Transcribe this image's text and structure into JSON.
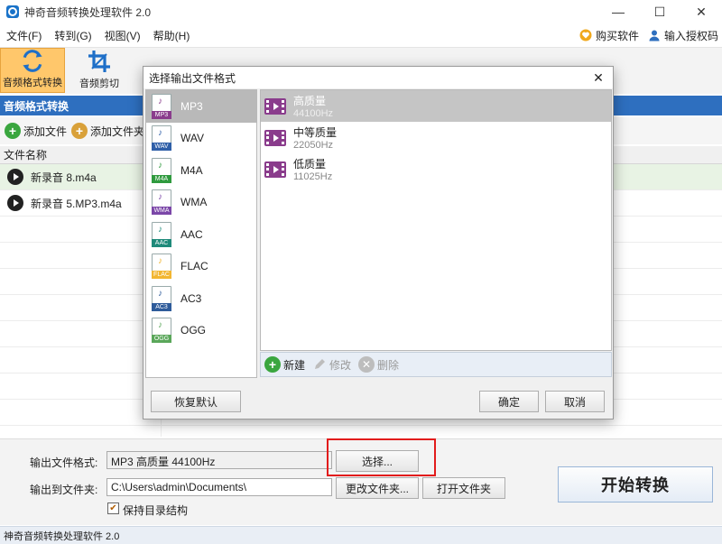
{
  "window": {
    "title": "神奇音频转换处理软件 2.0",
    "minimize_glyph": "—",
    "maximize_glyph": "☐",
    "close_glyph": "✕"
  },
  "menu": {
    "items": [
      "文件(F)",
      "转到(G)",
      "视图(V)",
      "帮助(H)"
    ],
    "buy": "购买软件",
    "license": "输入授权码"
  },
  "toolbar": {
    "tools": [
      {
        "label": "音频格式转换",
        "icon": "convert-icon",
        "active": true
      },
      {
        "label": "音频剪切",
        "icon": "crop-icon",
        "active": false
      }
    ]
  },
  "section": {
    "title": "音频格式转换"
  },
  "subtoolbar": {
    "add_file": "添加文件",
    "add_folder": "添加文件夹"
  },
  "filelist": {
    "header": "文件名称",
    "rows": [
      "新录音 8.m4a",
      "新录音 5.MP3.m4a"
    ]
  },
  "settings": {
    "output_format_label": "输出文件格式:",
    "output_format_value": "MP3 高质量 44100Hz",
    "select_button": "选择...",
    "output_folder_label": "输出到文件夹:",
    "output_folder_value": "C:\\Users\\admin\\Documents\\",
    "change_folder_button": "更改文件夹...",
    "open_folder_button": "打开文件夹",
    "keep_structure_label": "保持目录结构",
    "keep_structure_checked": true,
    "check_glyph": "✔",
    "start_button": "开始转换"
  },
  "status": {
    "text": "神奇音频转换处理软件 2.0"
  },
  "dialog": {
    "title": "选择输出文件格式",
    "close_glyph": "✕",
    "note_glyph": "♪",
    "formats": [
      {
        "name": "MP3",
        "tag": "MP3",
        "color": "#8a3c8c"
      },
      {
        "name": "WAV",
        "tag": "WAV",
        "color": "#2f5fa8"
      },
      {
        "name": "M4A",
        "tag": "M4A",
        "color": "#2f9a3e"
      },
      {
        "name": "WMA",
        "tag": "WMA",
        "color": "#7b47a8"
      },
      {
        "name": "AAC",
        "tag": "AAC",
        "color": "#1f8a7a"
      },
      {
        "name": "FLAC",
        "tag": "FLAC",
        "color": "#f2b632"
      },
      {
        "name": "AC3",
        "tag": "AC3",
        "color": "#2e5b9a"
      },
      {
        "name": "OGG",
        "tag": "OGG",
        "color": "#5aa75a"
      }
    ],
    "selected_format": "MP3",
    "qualities": [
      {
        "name": "高质量",
        "rate": "44100Hz",
        "selected": true
      },
      {
        "name": "中等质量",
        "rate": "22050Hz",
        "selected": false
      },
      {
        "name": "低质量",
        "rate": "11025Hz",
        "selected": false
      }
    ],
    "actions": {
      "new": "新建",
      "edit": "修改",
      "delete": "删除"
    },
    "reset_button": "恢复默认",
    "ok_button": "确定",
    "cancel_button": "取消"
  },
  "colors": {
    "accent": "#2e6fbf",
    "active_tool": "#ffc76b",
    "highlight": "#e21c1c"
  }
}
